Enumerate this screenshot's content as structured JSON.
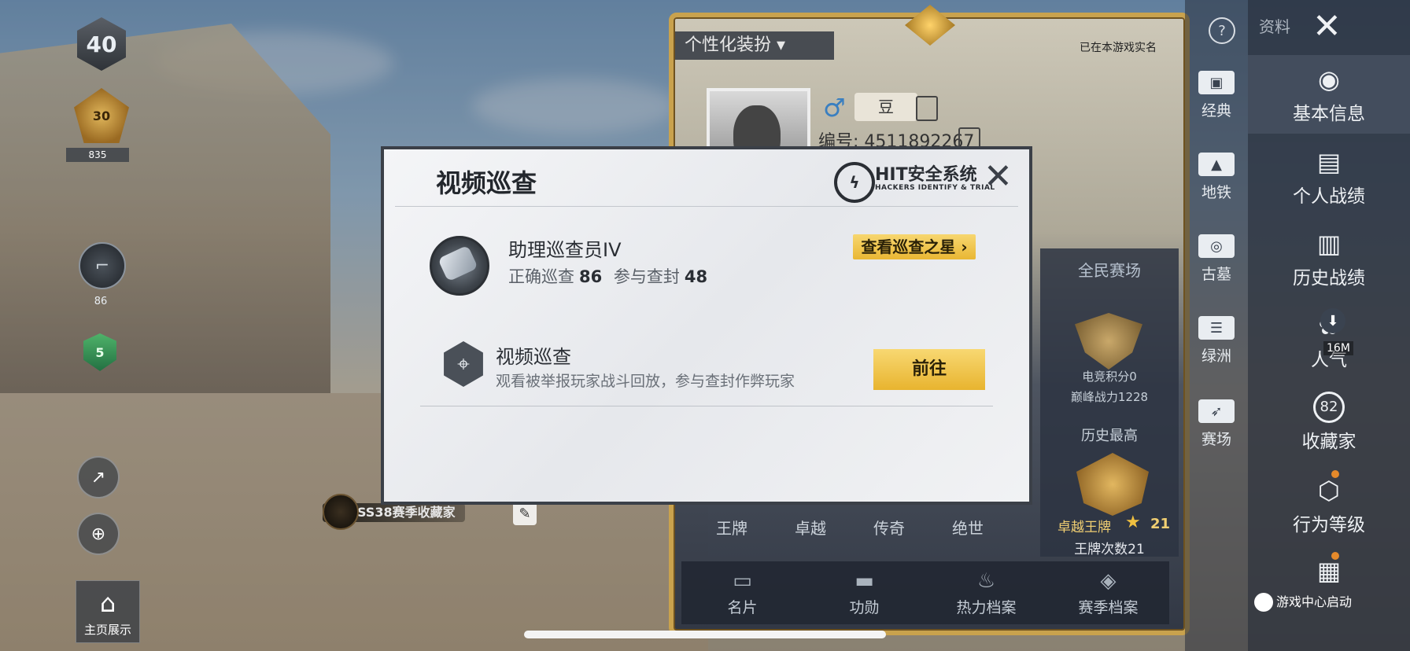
{
  "hud": {
    "level": "40",
    "rank_tier": "30",
    "rank_score": "835",
    "weapon_score": "86",
    "shield_value": "5",
    "home_label": "主页展示"
  },
  "collector_tag": "SS38赛季收藏家",
  "profile": {
    "custom_dress": "个性化装扮",
    "realname_note": "已在本游戏实名",
    "nickname": "豆",
    "id_text": "编号: 4511892267",
    "arena_title": "全民赛场",
    "arena_score": "电竞积分0",
    "arena_power": "巅峰战力1228",
    "history_title": "历史最高",
    "history_rank": "卓越王牌",
    "history_num": "21",
    "history_count": "王牌次数21",
    "tiers": [
      "王牌",
      "卓越",
      "传奇",
      "绝世"
    ],
    "bottom_tabs": [
      {
        "label": "名片",
        "icon": "id-card-icon"
      },
      {
        "label": "功勋",
        "icon": "medal-icon"
      },
      {
        "label": "热力档案",
        "icon": "flame-icon"
      },
      {
        "label": "赛季档案",
        "icon": "season-icon"
      }
    ]
  },
  "sidebar": {
    "header_label": "资料",
    "modes": [
      {
        "label": "经典",
        "icon": "classic-icon"
      },
      {
        "label": "地铁",
        "icon": "metro-icon"
      },
      {
        "label": "古墓",
        "icon": "tomb-icon"
      },
      {
        "label": "绿洲",
        "icon": "oasis-icon"
      },
      {
        "label": "赛场",
        "icon": "arena-icon"
      }
    ],
    "items": [
      {
        "label": "基本信息",
        "icon": "user-icon"
      },
      {
        "label": "个人战绩",
        "icon": "chart-icon"
      },
      {
        "label": "历史战绩",
        "icon": "history-icon"
      },
      {
        "label": "人气",
        "icon": "popularity-icon"
      },
      {
        "label": "收藏家",
        "icon": "collector-icon"
      },
      {
        "label": "行为等级",
        "icon": "behavior-icon"
      }
    ],
    "popularity_value": "16M",
    "collector_value": "82",
    "game_center": "游戏中心启动"
  },
  "modal": {
    "title": "视频巡查",
    "brand": "HIT安全系统",
    "brand_sub": "HACKERS IDENTIFY & TRIAL",
    "rank_name": "助理巡查员IV",
    "stat1_label": "正确巡查",
    "stat1_value": "86",
    "stat2_label": "参与查封",
    "stat2_value": "48",
    "star_button": "查看巡查之星",
    "feature_name": "视频巡查",
    "feature_desc": "观看被举报玩家战斗回放，参与查封作弊玩家",
    "go_button": "前往"
  }
}
